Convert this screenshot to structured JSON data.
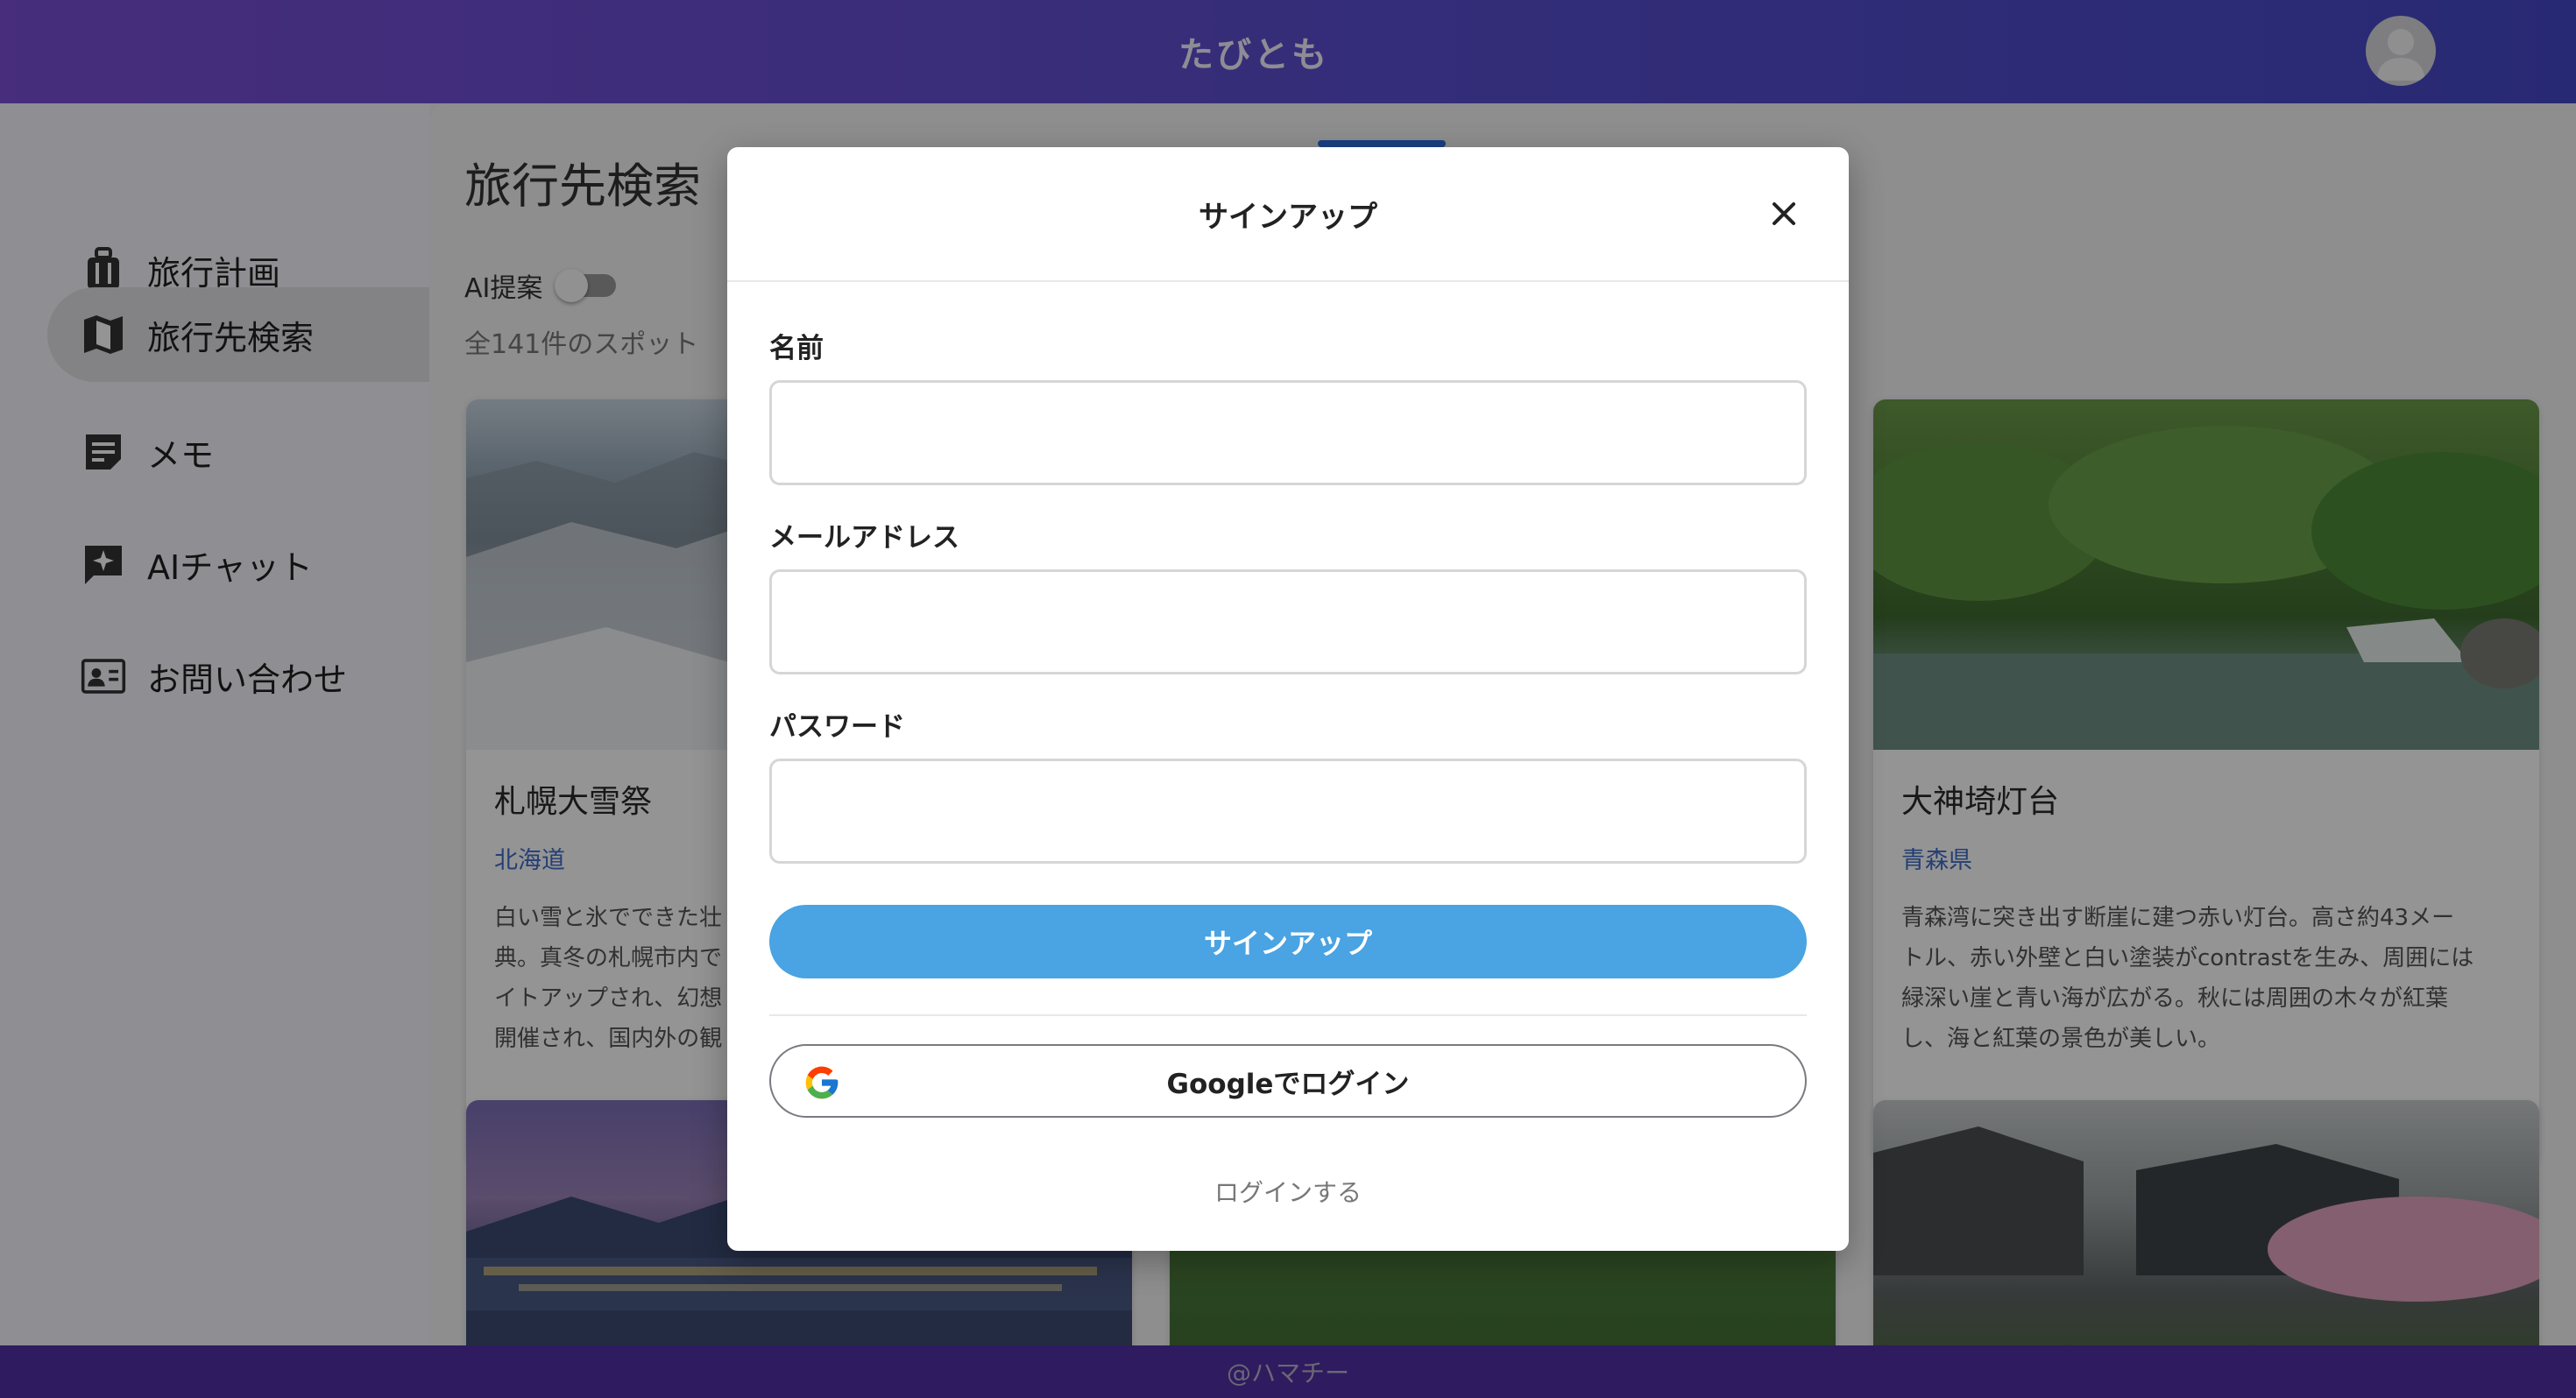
{
  "header": {
    "app_title": "たびとも",
    "avatar_icon": "user-avatar-icon"
  },
  "sidebar": {
    "items": [
      {
        "label": "旅行計画",
        "icon": "suitcase-icon",
        "active": false
      },
      {
        "label": "旅行先検索",
        "icon": "map-icon",
        "active": true
      },
      {
        "label": "メモ",
        "icon": "note-icon",
        "active": false
      },
      {
        "label": "AIチャット",
        "icon": "ai-chat-icon",
        "active": false
      },
      {
        "label": "お問い合わせ",
        "icon": "contact-card-icon",
        "active": false
      }
    ]
  },
  "main": {
    "page_title": "旅行先検索",
    "ai_toggle_label": "AI提案",
    "ai_toggle_on": false,
    "result_count": "全141件のスポット",
    "cards": [
      {
        "title": "札幌大雪祭",
        "prefecture": "北海道",
        "description": "白い雪と氷でできた壮\n典。真冬の札幌市内で\nイトアップされ、幻想\n開催され、国内外の観"
      },
      {
        "title": "大神埼灯台",
        "prefecture": "青森県",
        "description": "青森湾に突き出す断崖に建つ赤い灯台。高さ約43メー\nトル、赤い外壁と白い塗装がcontrastを生み、周囲には\n緑深い崖と青い海が広がる。秋には周囲の木々が紅葉\nし、海と紅葉の景色が美しい。"
      }
    ]
  },
  "modal": {
    "title": "サインアップ",
    "close_icon": "close-icon",
    "name_label": "名前",
    "name_value": "",
    "email_label": "メールアドレス",
    "email_value": "",
    "password_label": "パスワード",
    "password_value": "",
    "signup_button": "サインアップ",
    "google_button": "Googleでログイン",
    "google_icon": "google-icon",
    "login_link": "ログインする"
  },
  "footer": {
    "text": "@ハマチー"
  },
  "colors": {
    "header_start": "#7a4fd6",
    "header_end": "#4648c8",
    "primary_button": "#4aa3e2",
    "prefecture_link": "#3f6dc8",
    "footer": "#5030a6"
  }
}
